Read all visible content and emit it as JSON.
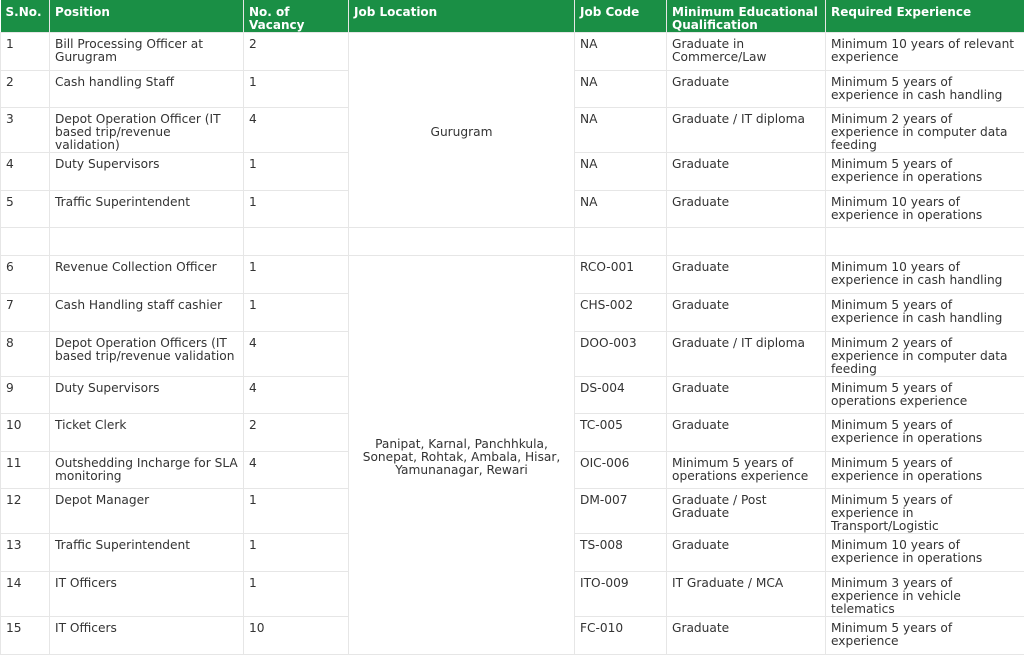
{
  "headers": [
    "S.No.",
    "Position",
    "No. of Vacancy",
    "Job Location",
    "Job Code",
    "Minimum Educational Qualification",
    "Required Experience"
  ],
  "group1": {
    "location": "Gurugram",
    "rows": [
      {
        "sno": "1",
        "position": "Bill Processing Officer at Gurugram",
        "vacancy": "2",
        "code": "NA",
        "qualification": "Graduate in Commerce/Law",
        "experience": "Minimum 10 years of relevant experience"
      },
      {
        "sno": "2",
        "position": "Cash handling Staff",
        "vacancy": "1",
        "code": "NA",
        "qualification": "Graduate",
        "experience": "Minimum 5 years of experience in cash handling"
      },
      {
        "sno": "3",
        "position": "Depot Operation Officer (IT based trip/revenue validation)",
        "vacancy": "4",
        "code": "NA",
        "qualification": "Graduate / IT diploma",
        "experience": "Minimum 2 years of experience in computer data feeding"
      },
      {
        "sno": "4",
        "position": "Duty Supervisors",
        "vacancy": "1",
        "code": "NA",
        "qualification": "Graduate",
        "experience": "Minimum 5 years of experience in operations"
      },
      {
        "sno": "5",
        "position": "Traffic Superintendent",
        "vacancy": "1",
        "code": "NA",
        "qualification": "Graduate",
        "experience": "Minimum 10 years of experience in operations"
      }
    ]
  },
  "group2": {
    "location": "Panipat, Karnal, Panchhkula, Sonepat, Rohtak, Ambala, Hisar, Yamunanagar, Rewari",
    "rows": [
      {
        "sno": "6",
        "position": "Revenue Collection Officer",
        "vacancy": "1",
        "code": "RCO-001",
        "qualification": "Graduate",
        "experience": "Minimum 10 years of experience in cash handling"
      },
      {
        "sno": "7",
        "position": "Cash Handling staff cashier",
        "vacancy": "1",
        "code": "CHS-002",
        "qualification": "Graduate",
        "experience": "Minimum 5 years of experience in cash handling"
      },
      {
        "sno": "8",
        "position": "Depot Operation Officers (IT based trip/revenue validation",
        "vacancy": "4",
        "code": "DOO-003",
        "qualification": "Graduate / IT diploma",
        "experience": "Minimum 2 years of experience in computer data feeding"
      },
      {
        "sno": "9",
        "position": "Duty Supervisors",
        "vacancy": "4",
        "code": "DS-004",
        "qualification": "Graduate",
        "experience": "Minimum 5 years of operations experience"
      },
      {
        "sno": "10",
        "position": "Ticket Clerk",
        "vacancy": "2",
        "code": "TC-005",
        "qualification": "Graduate",
        "experience": "Minimum 5 years of experience in operations"
      },
      {
        "sno": "11",
        "position": "Outshedding Incharge for SLA monitoring",
        "vacancy": "4",
        "code": "OIC-006",
        "qualification": "Minimum 5 years of operations experience",
        "experience": "Minimum 5 years of experience in operations"
      },
      {
        "sno": "12",
        "position": "Depot Manager",
        "vacancy": "1",
        "code": "DM-007",
        "qualification": "Graduate / Post Graduate",
        "experience": "Minimum 5 years of experience in Transport/Logistic"
      },
      {
        "sno": "13",
        "position": "Traffic Superintendent",
        "vacancy": "1",
        "code": "TS-008",
        "qualification": "Graduate",
        "experience": "Minimum 10 years of experience in operations"
      },
      {
        "sno": "14",
        "position": "IT Officers",
        "vacancy": "1",
        "code": "ITO-009",
        "qualification": "IT Graduate / MCA",
        "experience": "Minimum 3 years of experience in vehicle telematics"
      },
      {
        "sno": "15",
        "position": "IT Officers",
        "vacancy": "10",
        "code": "FC-010",
        "qualification": "Graduate",
        "experience": "Minimum 5 years of experience"
      }
    ]
  }
}
